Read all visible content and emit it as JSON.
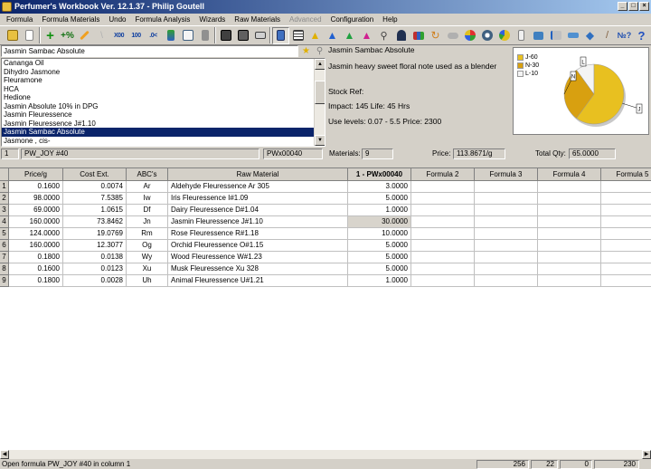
{
  "app": {
    "title": "Perfumer's Workbook Ver. 12.1.37 - Philip Goutell"
  },
  "menu": [
    "Formula",
    "Formula Materials",
    "Undo",
    "Formula Analysis",
    "Wizards",
    "Raw Materials",
    "Advanced",
    "Configuration",
    "Help"
  ],
  "toolbar": {
    "t1": "X00",
    "t2": "100",
    "t3": ".0<"
  },
  "search": {
    "value": "Jasmin Sambac Absolute"
  },
  "material_list": {
    "items": [
      "Cananga Oil",
      "Dihydro Jasmone",
      "Fleuramone",
      "HCA",
      "Hedione",
      "Jasmin Absolute 10% in DPG",
      "Jasmin Fleuressence",
      "Jasmin Fleuressence J#1.10",
      "Jasmin Sambac Absolute",
      "Jasmone , cis-"
    ],
    "selected": "Jasmin Sambac Absolute"
  },
  "material_info": {
    "name": "Jasmin Sambac Absolute",
    "description": "Jasmin heavy sweet floral note used as a blender",
    "stock_ref": "Stock Ref:",
    "impact_life": "Impact: 145  Life: 45 Hrs",
    "levels_price": "Use levels: 0.07 - 5.5  Price: 2300"
  },
  "chart_data": {
    "type": "pie",
    "categories": [
      "J",
      "N",
      "L"
    ],
    "values": [
      60,
      30,
      10
    ],
    "legend": [
      "J-60",
      "N-30",
      "L-10"
    ],
    "slice_labels": [
      "J",
      "N",
      "L"
    ],
    "colors": [
      "#e8c020",
      "#d8a010",
      "#f4f4f4"
    ],
    "legend_position": "left"
  },
  "formula_stats": {
    "row": "1",
    "name": "PW_JOY #40",
    "code": "PWx00040",
    "materials_label": "Materials:",
    "materials": "9",
    "price_label": "Price:",
    "price": "113.8671/g",
    "total_label": "Total Qty:",
    "total": "65.0000"
  },
  "grid": {
    "columns": [
      "Price/g",
      "Cost Ext.",
      "ABC's",
      "Raw Material",
      "1 - PWx00040",
      "Formula 2",
      "Formula 3",
      "Formula 4",
      "Formula 5"
    ],
    "rows": [
      {
        "n": "1",
        "price": "0.1600",
        "cost": "0.0074",
        "abc": "Ar",
        "material": "Aldehyde Fleuressence Ar 305",
        "qty": "3.0000"
      },
      {
        "n": "2",
        "price": "98.0000",
        "cost": "7.5385",
        "abc": "Iw",
        "material": "Iris Fleuressence I#1.09",
        "qty": "5.0000"
      },
      {
        "n": "3",
        "price": "69.0000",
        "cost": "1.0615",
        "abc": "Df",
        "material": "Dairy Fleuressence D#1.04",
        "qty": "1.0000"
      },
      {
        "n": "4",
        "price": "160.0000",
        "cost": "73.8462",
        "abc": "Jn",
        "material": "Jasmin Fleuressence J#1.10",
        "qty": "30.0000"
      },
      {
        "n": "5",
        "price": "124.0000",
        "cost": "19.0769",
        "abc": "Rm",
        "material": "Rose Fleuressence  R#1.18",
        "qty": "10.0000"
      },
      {
        "n": "6",
        "price": "160.0000",
        "cost": "12.3077",
        "abc": "Og",
        "material": "Orchid Fleuressence O#1.15",
        "qty": "5.0000"
      },
      {
        "n": "7",
        "price": "0.1800",
        "cost": "0.0138",
        "abc": "Wy",
        "material": "Wood Fleuressence W#1.23",
        "qty": "5.0000"
      },
      {
        "n": "8",
        "price": "0.1600",
        "cost": "0.0123",
        "abc": "Xu",
        "material": "Musk Fleuressence Xu 328",
        "qty": "5.0000"
      },
      {
        "n": "9",
        "price": "0.1800",
        "cost": "0.0028",
        "abc": "Uh",
        "material": "Animal Fleuressence U#1.21",
        "qty": "1.0000"
      }
    ]
  },
  "status": {
    "message": "Open formula PW_JOY #40 in column 1",
    "p1": "256",
    "p2": "22",
    "p3": "0",
    "p4": "230"
  }
}
